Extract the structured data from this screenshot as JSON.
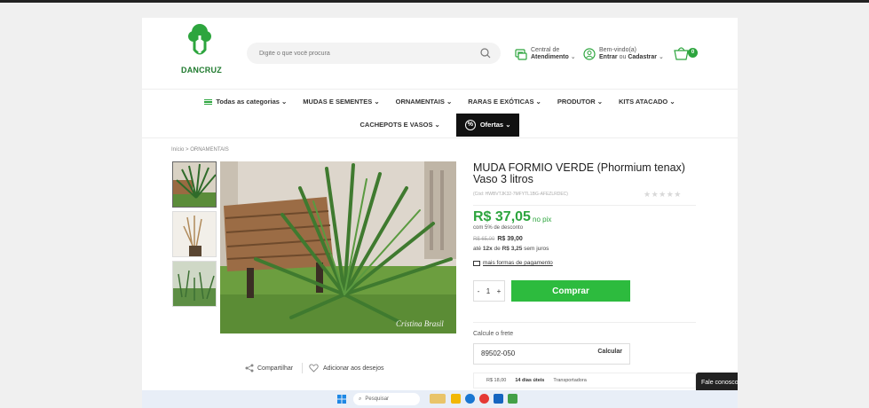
{
  "header": {
    "logo_text": "DANCRUZ",
    "search_placeholder": "Digite o que você procura",
    "support_line1": "Central de",
    "support_line2": "Atendimento",
    "account_line1": "Bem-vindo(a)",
    "account_login": "Entrar",
    "account_or": "ou",
    "account_register": "Cadastrar",
    "cart_count": "0"
  },
  "nav": {
    "row1": [
      "Todas as categorias",
      "MUDAS E SEMENTES",
      "ORNAMENTAIS",
      "RARAS E EXÓTICAS",
      "PRODUTOR",
      "KITS ATACADO"
    ],
    "row2": [
      "CACHEPOTS E VASOS",
      "Ofertas"
    ]
  },
  "breadcrumb": {
    "home": "Início",
    "sep": ">",
    "current": "ORNAMENTAIS"
  },
  "product": {
    "title": "MUDA FORMIO VERDE (Phormium tenax) Vaso 3 litros",
    "code": "(Cód: HWBVTJK32-7MFYTL1BG-AFEZLRDEC)",
    "price": "R$ 37,05",
    "price_suffix": "no pix",
    "discount": "com 5% de desconto",
    "old_price": "R$ 65,00",
    "regular_price": "R$ 39,00",
    "installments_prefix": "até",
    "installments_count": "12x",
    "installments_of": "de",
    "installments_value": "R$ 3,25",
    "installments_suffix": "sem juros",
    "payment_link": "mais formas de pagamento",
    "quantity": "1",
    "qty_minus": "-",
    "qty_plus": "+",
    "buy_label": "Comprar",
    "stars": "★★★★★",
    "image_watermark": "Cristina Brasil"
  },
  "actions": {
    "share": "Compartilhar",
    "wishlist": "Adicionar aos desejos"
  },
  "freight": {
    "label": "Calcule o frete",
    "cep": "89502-050",
    "button": "Calcular",
    "option_price": "R$ 18,00",
    "option_days": "14 dias úteis",
    "option_carrier": "Transportadora"
  },
  "chat": {
    "label": "Fale conosco"
  },
  "taskbar": {
    "search_label": "Pesquisar"
  },
  "colors": {
    "brand_green": "#2da53e",
    "buy_green": "#2dbb3e",
    "offer_black": "#111111"
  },
  "icons": [
    "search-icon",
    "support-icon",
    "user-icon",
    "cart-icon",
    "menu-icon",
    "discount-icon",
    "share-icon",
    "heart-icon",
    "card-icon",
    "star-icon",
    "windows-icon"
  ]
}
